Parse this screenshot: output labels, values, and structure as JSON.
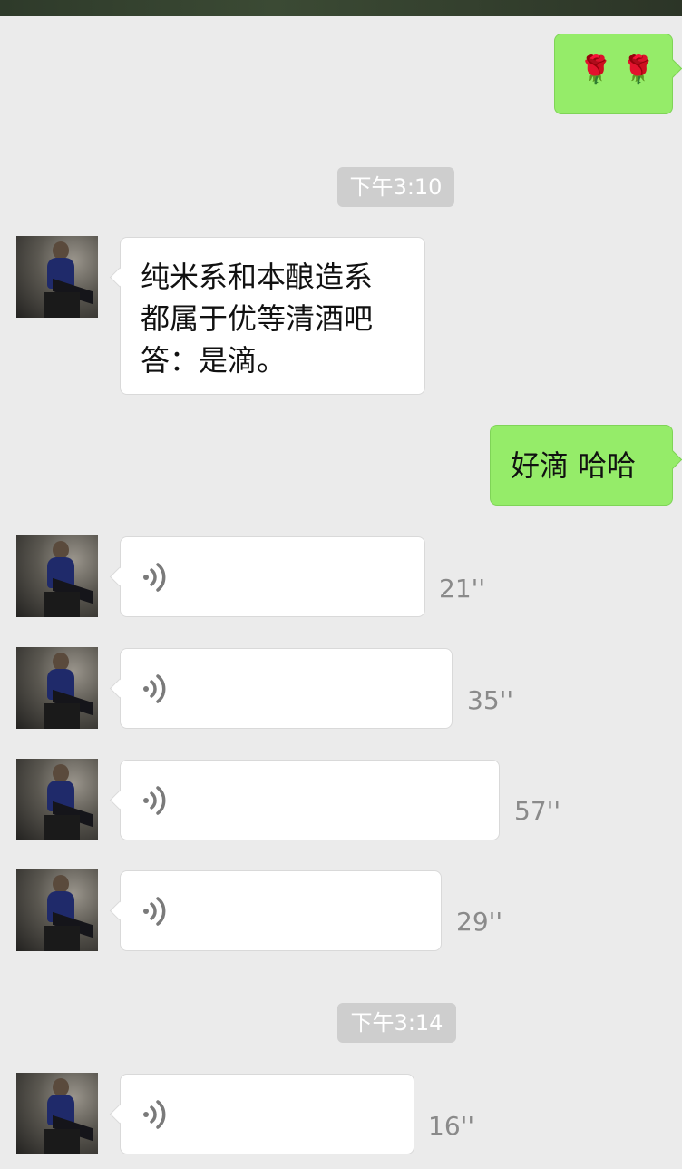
{
  "sent_rose": {
    "emoji": "🌹🌹"
  },
  "timestamps": [
    "下午3:10",
    "下午3:14"
  ],
  "received_text": {
    "lines": [
      "纯米系和本酿造系",
      "都属于优等清酒吧",
      "答：是滴。"
    ]
  },
  "sent_text": {
    "text": "好滴 哈哈"
  },
  "voice_messages": [
    {
      "duration": "21''"
    },
    {
      "duration": "35''"
    },
    {
      "duration": "57''"
    },
    {
      "duration": "29''"
    },
    {
      "duration": "16''"
    }
  ],
  "icons": {
    "voice": "voice-wave-icon",
    "avatar": "contact-avatar"
  },
  "colors": {
    "background": "#ebebeb",
    "outgoing_bubble": "#95ec69",
    "incoming_bubble": "#ffffff",
    "timestamp_badge": "#cecece"
  }
}
